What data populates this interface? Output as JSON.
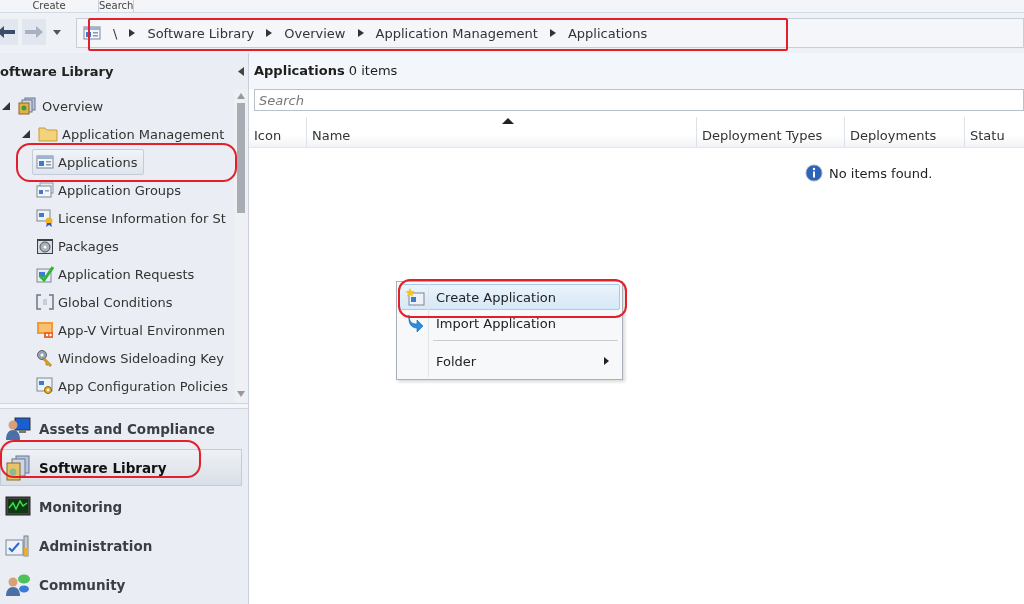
{
  "ribbon_groups": [
    "Create",
    "Search"
  ],
  "breadcrumb": [
    "\\",
    "Software Library",
    "Overview",
    "Application Management",
    "Applications"
  ],
  "navigation_pane": {
    "title": "oftware Library",
    "tree": [
      {
        "label": "Overview",
        "expanded": true,
        "selected": false,
        "children": [
          {
            "label": "Application Management",
            "expanded": true,
            "selected": false,
            "children": [
              {
                "label": "Applications",
                "selected": true
              },
              {
                "label": "Application Groups",
                "selected": false
              },
              {
                "label": "License Information for St",
                "selected": false
              },
              {
                "label": "Packages",
                "selected": false
              },
              {
                "label": "Application Requests",
                "selected": false
              },
              {
                "label": "Global Conditions",
                "selected": false
              },
              {
                "label": "App-V Virtual Environmen",
                "selected": false
              },
              {
                "label": "Windows Sideloading Key",
                "selected": false
              },
              {
                "label": "App Configuration Policies",
                "selected": false
              }
            ]
          }
        ]
      }
    ]
  },
  "workspaces": [
    {
      "label": "Assets and Compliance",
      "selected": false
    },
    {
      "label": "Software Library",
      "selected": true
    },
    {
      "label": "Monitoring",
      "selected": false
    },
    {
      "label": "Administration",
      "selected": false
    },
    {
      "label": "Community",
      "selected": false
    }
  ],
  "list": {
    "title": "**Applications** 0 items",
    "search": {
      "placeholder": "Search"
    },
    "columns": [
      {
        "label": "Icon",
        "sorted": false
      },
      {
        "label": "Name",
        "sorted": true
      },
      {
        "label": "Deployment Types",
        "sorted": false
      },
      {
        "label": "Deployments",
        "sorted": false
      },
      {
        "label": "Statu",
        "sorted": false
      }
    ],
    "empty_message": "No items found."
  },
  "context_menu": [
    {
      "kind": "item",
      "label": "Create Application",
      "selected": true
    },
    {
      "kind": "item",
      "label": "Import Application",
      "selected": false
    },
    {
      "kind": "separator"
    },
    {
      "kind": "submenu",
      "label": "Folder",
      "selected": false
    }
  ]
}
